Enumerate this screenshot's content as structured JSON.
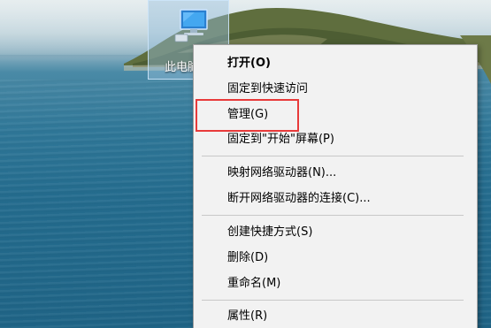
{
  "desktop": {
    "icon": {
      "label": "此电脑",
      "icon_name": "this-pc-icon"
    }
  },
  "context_menu": {
    "items": [
      {
        "label": "打开(O)",
        "bold": true
      },
      {
        "label": "固定到快速访问"
      },
      {
        "label": "管理(G)",
        "highlighted": true
      },
      {
        "label": "固定到\"开始\"屏幕(P)"
      },
      {
        "label": "映射网络驱动器(N)..."
      },
      {
        "label": "断开网络驱动器的连接(C)..."
      },
      {
        "label": "创建快捷方式(S)"
      },
      {
        "label": "删除(D)"
      },
      {
        "label": "重命名(M)"
      },
      {
        "label": "属性(R)"
      }
    ]
  },
  "colors": {
    "highlight_border": "#e83a3a",
    "menu_background": "#f2f2f2",
    "icon_selection": "#96bedc"
  }
}
